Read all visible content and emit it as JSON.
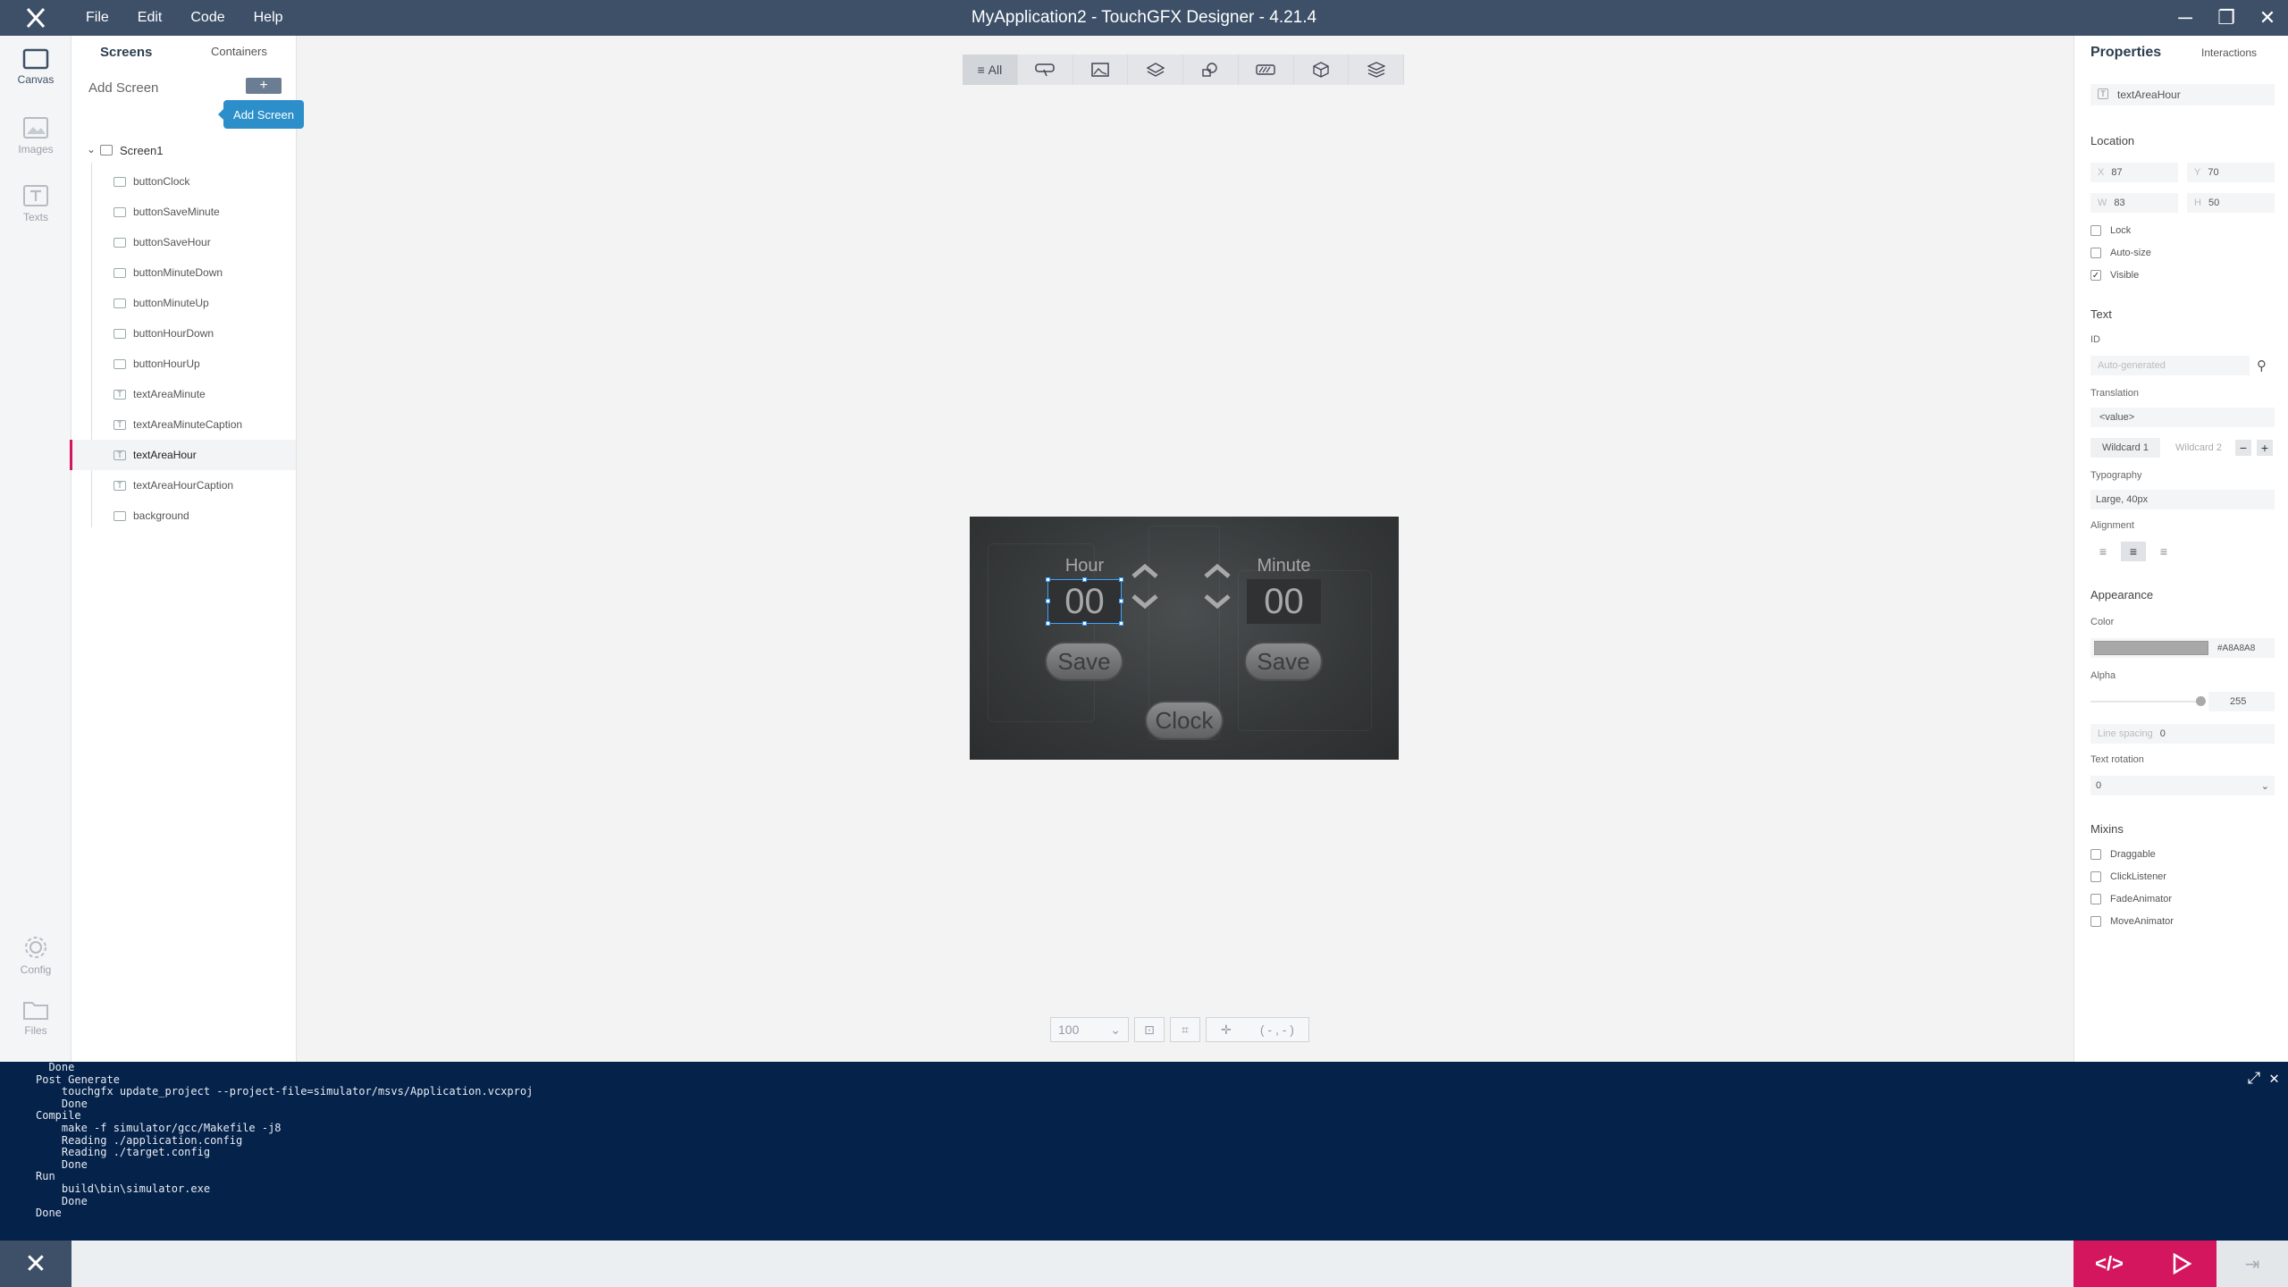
{
  "app": {
    "title": "MyApplication2 - TouchGFX Designer - 4.21.4",
    "menu": [
      "File",
      "Edit",
      "Code",
      "Help"
    ],
    "window_controls": [
      "─",
      "❐",
      "✕"
    ]
  },
  "leftnav": {
    "items": [
      {
        "label": "Canvas",
        "icon": "canvas-icon",
        "active": true
      },
      {
        "label": "Images",
        "icon": "image-icon"
      },
      {
        "label": "Texts",
        "icon": "text-icon"
      },
      {
        "label": "Config",
        "icon": "gear-icon"
      },
      {
        "label": "Files",
        "icon": "folder-icon"
      }
    ]
  },
  "screens_panel": {
    "tab_screens": "Screens",
    "tab_containers": "Containers",
    "add_screen_label": "Add Screen",
    "add_plus": "+",
    "tooltip": "Add Screen",
    "screen_name": "Screen1",
    "widgets": [
      {
        "name": "buttonClock",
        "type": "button"
      },
      {
        "name": "buttonSaveMinute",
        "type": "button"
      },
      {
        "name": "buttonSaveHour",
        "type": "button"
      },
      {
        "name": "buttonMinuteDown",
        "type": "button"
      },
      {
        "name": "buttonMinuteUp",
        "type": "button"
      },
      {
        "name": "buttonHourDown",
        "type": "button"
      },
      {
        "name": "buttonHourUp",
        "type": "button"
      },
      {
        "name": "textAreaMinute",
        "type": "text"
      },
      {
        "name": "textAreaMinuteCaption",
        "type": "text"
      },
      {
        "name": "textAreaHour",
        "type": "text",
        "selected": true
      },
      {
        "name": "textAreaHourCaption",
        "type": "text"
      },
      {
        "name": "background",
        "type": "image"
      }
    ]
  },
  "canvas": {
    "filter_all": "All",
    "device": {
      "hour_caption": "Hour",
      "minute_caption": "Minute",
      "hour_value": "00",
      "minute_value": "00",
      "save_left": "Save",
      "save_right": "Save",
      "clock": "Clock"
    },
    "zoom": "100",
    "coords": "( - , - )"
  },
  "properties": {
    "tab_properties": "Properties",
    "tab_interactions": "Interactions",
    "widget_name": "textAreaHour",
    "location_title": "Location",
    "x_label": "X",
    "x": "87",
    "y_label": "Y",
    "y": "70",
    "w_label": "W",
    "w": "83",
    "h_label": "H",
    "h": "50",
    "lock": "Lock",
    "autosize": "Auto-size",
    "visible": "Visible",
    "text_title": "Text",
    "id_label": "ID",
    "id_placeholder": "Auto-generated",
    "translation_label": "Translation",
    "translation_value": "<value>",
    "wildcard1": "Wildcard 1",
    "wildcard2": "Wildcard 2",
    "typography_label": "Typography",
    "typography_value": "Large, 40px",
    "alignment_label": "Alignment",
    "appearance_title": "Appearance",
    "color_label": "Color",
    "color_value": "#A8A8A8",
    "alpha_label": "Alpha",
    "alpha_value": "255",
    "line_spacing_label": "Line spacing",
    "line_spacing_value": "0",
    "text_rotation_label": "Text rotation",
    "text_rotation_value": "0",
    "mixins_title": "Mixins",
    "mixins": [
      "Draggable",
      "ClickListener",
      "FadeAnimator",
      "MoveAnimator"
    ]
  },
  "console": {
    "lines": [
      "  Done",
      "Post Generate",
      "    touchgfx update_project --project-file=simulator/msvs/Application.vcxproj",
      "    Done",
      "Compile",
      "    make -f simulator/gcc/Makefile -j8",
      "    Reading ./application.config",
      "    Reading ./target.config",
      "    Done",
      "Run",
      "    build\\bin\\simulator.exe",
      "    Done",
      "Done"
    ]
  },
  "bottombar": {
    "close": "✕",
    "code": "</>"
  },
  "colors": {
    "titlebar": "#3d5068",
    "accent": "#d4165f",
    "console_bg": "#05224a",
    "tooltip": "#2c8fc9",
    "selection": "#3fa3ff"
  }
}
